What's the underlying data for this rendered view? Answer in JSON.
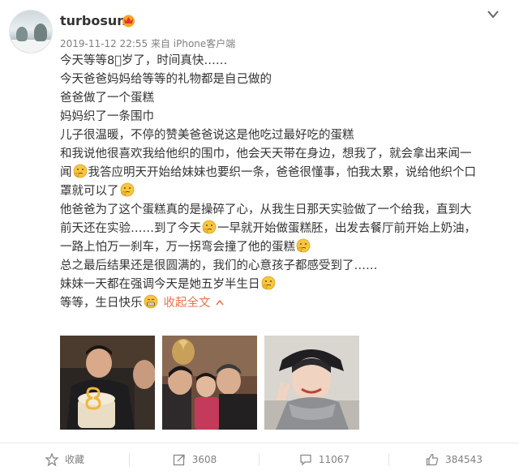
{
  "post": {
    "username": "turbosun",
    "meta": "2019-11-12 22:55 来自 iPhone客户端",
    "lines": [
      [
        {
          "t": "今天等等8⃣岁了，时间真快……"
        }
      ],
      [
        {
          "t": "今天爸爸妈妈给等等的礼物都是自己做的"
        }
      ],
      [
        {
          "t": "爸爸做了一个蛋糕"
        }
      ],
      [
        {
          "t": "妈妈织了一条围巾"
        }
      ],
      [
        {
          "t": "儿子很温暖，不停的赞美爸爸说这是他吃过最好吃的蛋糕"
        }
      ],
      [
        {
          "t": "和我说他很喜欢我给他织的围巾，他会天天带在身边，想我了，就会拿出来闻一"
        }
      ],
      [
        {
          "t": "闻"
        },
        {
          "e": "think"
        },
        {
          "t": "我答应明天开始给妹妹也要织一条，爸爸很懂事，怕我太累，说给他织个口"
        }
      ],
      [
        {
          "t": "罩就可以了"
        },
        {
          "e": "think"
        }
      ],
      [
        {
          "t": "他爸爸为了这个蛋糕真的是操碎了心，从我生日那天实验做了一个给我，直到大"
        }
      ],
      [
        {
          "t": "前天还在实验……到了今天"
        },
        {
          "e": "think"
        },
        {
          "t": "一早就开始做蛋糕胚，出发去餐厅前开始上奶油，"
        }
      ],
      [
        {
          "t": "一路上怕万一刹车，万一拐弯会撞了他的蛋糕"
        },
        {
          "e": "think"
        }
      ],
      [
        {
          "t": "总之最后结果还是很圆满的，我们的心意孩子都感受到了……"
        }
      ],
      [
        {
          "t": "妹妹一天都在强调今天是她五岁半生日"
        },
        {
          "e": "think"
        }
      ],
      [
        {
          "t": "等等，生日快乐"
        },
        {
          "e": "grin"
        }
      ]
    ],
    "collapse_label": "收起全文"
  },
  "photos": [
    {
      "name": "photo-boy-with-cake"
    },
    {
      "name": "photo-family-kiss"
    },
    {
      "name": "photo-mother-selfie"
    }
  ],
  "actions": {
    "favorite_label": "收藏",
    "repost_count": "3608",
    "comment_count": "11067",
    "like_count": "384543"
  },
  "colors": {
    "accent": "#eb7350",
    "text": "#333333",
    "muted": "#808080",
    "emoji": "#f7c640"
  }
}
